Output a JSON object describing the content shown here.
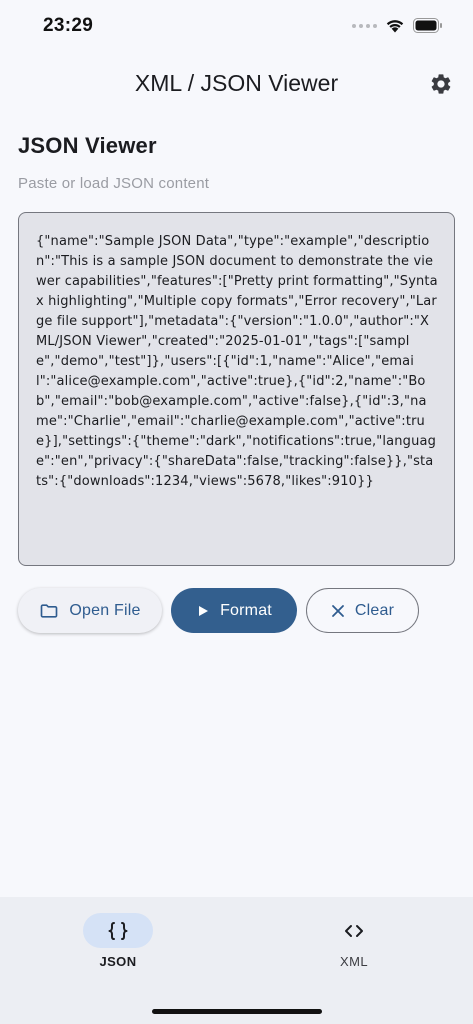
{
  "status_bar": {
    "time": "23:29",
    "icons": [
      "signal-dots-icon",
      "wifi-icon",
      "battery-icon"
    ]
  },
  "app_bar": {
    "title": "XML / JSON Viewer",
    "settings_icon": "gear-icon"
  },
  "main": {
    "title": "JSON Viewer",
    "subtitle": "Paste or load JSON content",
    "json_content": "{\"name\":\"Sample JSON Data\",\"type\":\"example\",\"description\":\"This is a sample JSON document to demonstrate the viewer capabilities\",\"features\":[\"Pretty print formatting\",\"Syntax highlighting\",\"Multiple copy formats\",\"Error recovery\",\"Large file support\"],\"metadata\":{\"version\":\"1.0.0\",\"author\":\"XML/JSON Viewer\",\"created\":\"2025-01-01\",\"tags\":[\"sample\",\"demo\",\"test\"]},\"users\":[{\"id\":1,\"name\":\"Alice\",\"email\":\"alice@example.com\",\"active\":true},{\"id\":2,\"name\":\"Bob\",\"email\":\"bob@example.com\",\"active\":false},{\"id\":3,\"name\":\"Charlie\",\"email\":\"charlie@example.com\",\"active\":true}],\"settings\":{\"theme\":\"dark\",\"notifications\":true,\"language\":\"en\",\"privacy\":{\"shareData\":false,\"tracking\":false}},\"stats\":{\"downloads\":1234,\"views\":5678,\"likes\":910}}"
  },
  "actions": {
    "open_file": "Open File",
    "format": "Format",
    "clear": "Clear"
  },
  "bottom_nav": {
    "items": [
      {
        "label": "JSON",
        "icon": "braces-icon",
        "selected": true
      },
      {
        "label": "XML",
        "icon": "code-icon",
        "selected": false
      }
    ]
  },
  "colors": {
    "primary": "#335f8e",
    "background": "#f7f8fc",
    "editor_background": "#e2e3e9",
    "nav_selected_pill": "#d5e2f6"
  }
}
